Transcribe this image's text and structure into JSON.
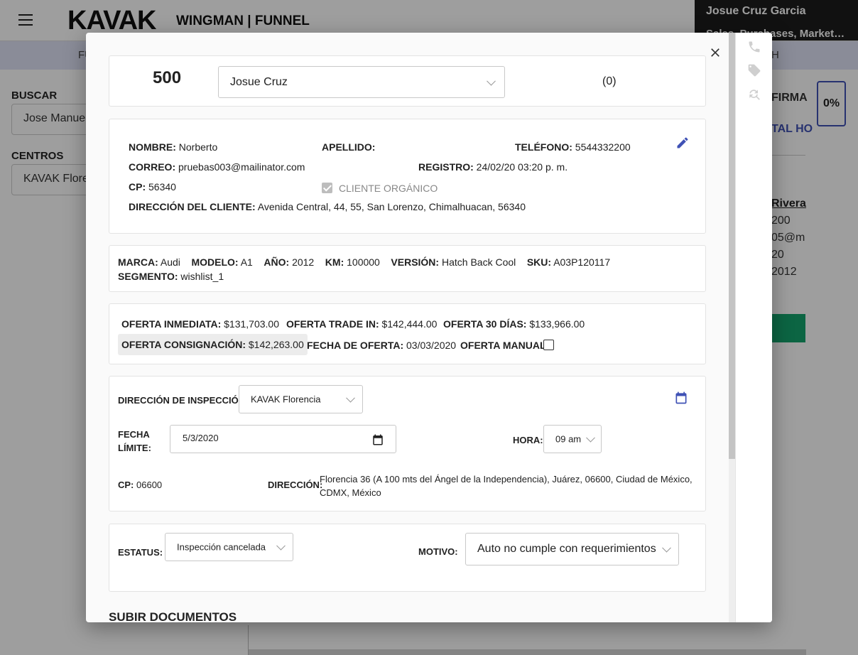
{
  "app": {
    "logo": "KAVAK",
    "title": "WINGMAN | FUNNEL",
    "user_name": "Josue Cruz Garcia",
    "user_roles": "Sales, Purchases, Market…",
    "nav_left": "FU",
    "nav_right": "H"
  },
  "sidebar": {
    "search_label": "BUSCAR",
    "search_value": "Jose Manue",
    "centers_label": "CENTROS",
    "centers_value": "KAVAK Flore"
  },
  "right_panel": {
    "firma": "FIRMA",
    "percent": "0%",
    "total": "TAL HO",
    "rivera": "Rivera",
    "line1": "200",
    "line2": "05@m",
    "line3": "20",
    "line4": "2012"
  },
  "modal": {
    "header": {
      "lead_number": "500",
      "agent_select": "Josue Cruz",
      "count": "(0)"
    },
    "client": {
      "nombre_label": "NOMBRE:",
      "nombre": "Norberto",
      "apellido_label": "APELLIDO:",
      "apellido": "",
      "telefono_label": "TELÉFONO:",
      "telefono": "5544332200",
      "correo_label": "CORREO:",
      "correo": "pruebas003@mailinator.com",
      "registro_label": "REGISTRO:",
      "registro": "24/02/20 03:20 p. m.",
      "cp_label": "CP:",
      "cp": "56340",
      "organico_label": "CLIENTE ORGÁNICO",
      "direccion_label": "DIRECCIÓN DEL CLIENTE:",
      "direccion": "Avenida Central, 44, 55, San Lorenzo, Chimalhuacan, 56340"
    },
    "car": {
      "marca_label": "MARCA:",
      "marca": "Audi",
      "modelo_label": "MODELO:",
      "modelo": "A1",
      "anio_label": "AÑO:",
      "anio": "2012",
      "km_label": "KM:",
      "km": "100000",
      "version_label": "VERSIÓN:",
      "version": "Hatch Back Cool",
      "sku_label": "SKU:",
      "sku": "A03P120117",
      "segmento_label": "SEGMENTO:",
      "segmento": "wishlist_1"
    },
    "offers": {
      "inmediata_label": "OFERTA INMEDIATA:",
      "inmediata": "$131,703.00",
      "tradein_label": "OFERTA TRADE IN:",
      "tradein": "$142,444.00",
      "dias30_label": "OFERTA 30 DÍAS:",
      "dias30": "$133,966.00",
      "consignacion_label": "OFERTA CONSIGNACIÓN:",
      "consignacion": "$142,263.00",
      "fecha_label": "FECHA DE OFERTA:",
      "fecha": "03/03/2020",
      "manual_label": "OFERTA MANUAL"
    },
    "inspection": {
      "direccion_label": "DIRECCIÓN DE INSPECCIÓN:",
      "direccion_select": "KAVAK Florencia",
      "fecha_label_1": "FECHA",
      "fecha_label_2": "LÍMITE:",
      "fecha_value": "5/3/2020",
      "hora_label": "HORA:",
      "hora_value": "09 am",
      "cp_label": "CP:",
      "cp": "06600",
      "direccion2_label": "DIRECCIÓN:",
      "direccion2_line1": "Florencia 36 (A 100 mts del Ángel de la Independencia), Juárez, 06600, Ciudad de México,",
      "direccion2_line2": "CDMX, México"
    },
    "status": {
      "estatus_label": "ESTATUS:",
      "estatus_value": "Inspección cancelada",
      "motivo_label": "MOTIVO:",
      "motivo_value": "Auto no cumple con requerimientos"
    },
    "upload_title": "SUBIR DOCUMENTOS"
  },
  "colors": {
    "accent": "#3f51b5",
    "green": "#14a36c",
    "nav": "#dfe3f5"
  }
}
